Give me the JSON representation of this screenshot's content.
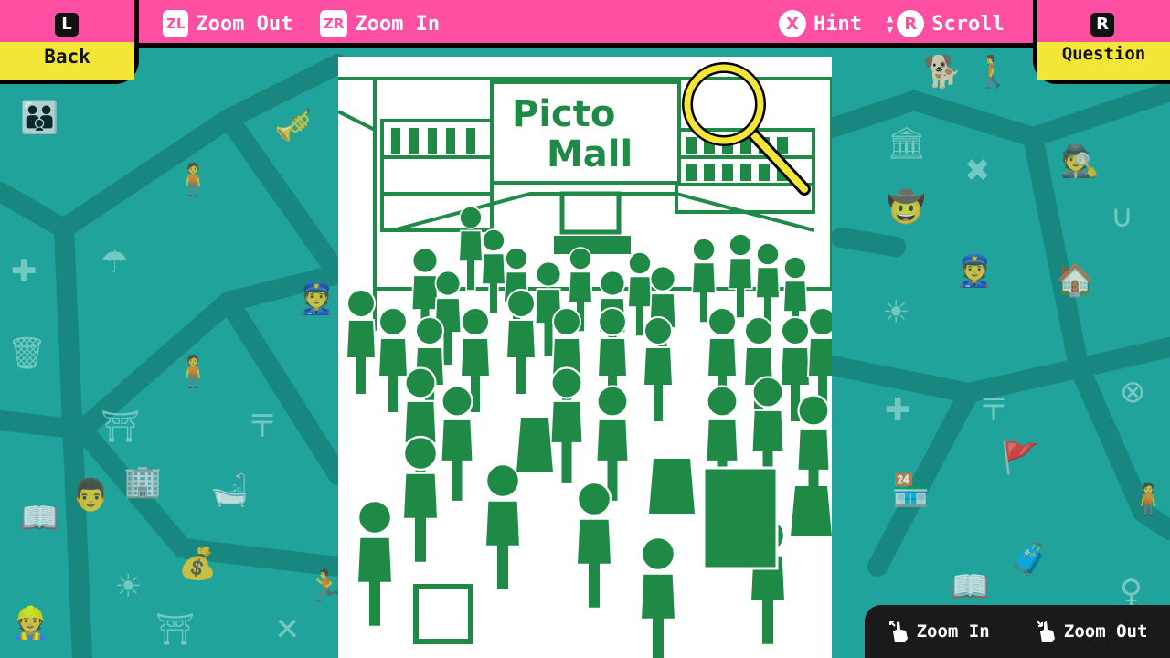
{
  "top_bar": {
    "back": {
      "key": "L",
      "label": "Back"
    },
    "zoom_out": {
      "key": "ZL",
      "label": "Zoom Out"
    },
    "zoom_in": {
      "key": "ZR",
      "label": "Zoom In"
    },
    "hint": {
      "key": "X",
      "label": "Hint"
    },
    "scroll": {
      "key": "R",
      "label": "Scroll"
    },
    "question": {
      "key": "R",
      "label": "Question"
    }
  },
  "puzzle": {
    "sign_line1": "Picto",
    "sign_line2": "Mall"
  },
  "touch_controls": {
    "zoom_in": "Zoom In",
    "zoom_out": "Zoom Out"
  },
  "colors": {
    "top_bar": "#ff4fa3",
    "tab": "#f4e637",
    "background": "#1fa39a",
    "figures": "#1e8a45",
    "magnifier": "#f4e637"
  }
}
